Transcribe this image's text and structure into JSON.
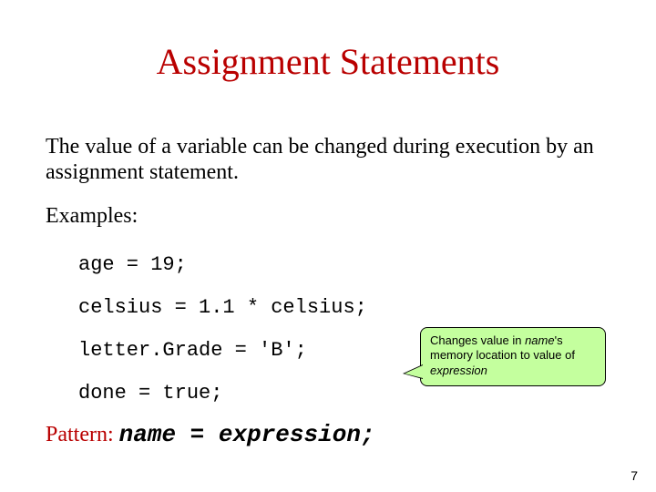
{
  "title": "Assignment Statements",
  "intro": "The value of a variable can be changed during execution by an assignment statement.",
  "examples_label": "Examples:",
  "code": {
    "ex1": "age = 19;",
    "ex2": "celsius = 1.1 * celsius;",
    "ex3": "letter.Grade = 'B';",
    "ex4": "done = true;"
  },
  "pattern": {
    "label": "Pattern:",
    "name": "name",
    "eq": " = ",
    "expr": "expression",
    "end": ";"
  },
  "callout": {
    "l1a": "Changes value in ",
    "l1b": "name",
    "l1c": "'s memory location to value of ",
    "l1d": "expression"
  },
  "page_number": "7"
}
